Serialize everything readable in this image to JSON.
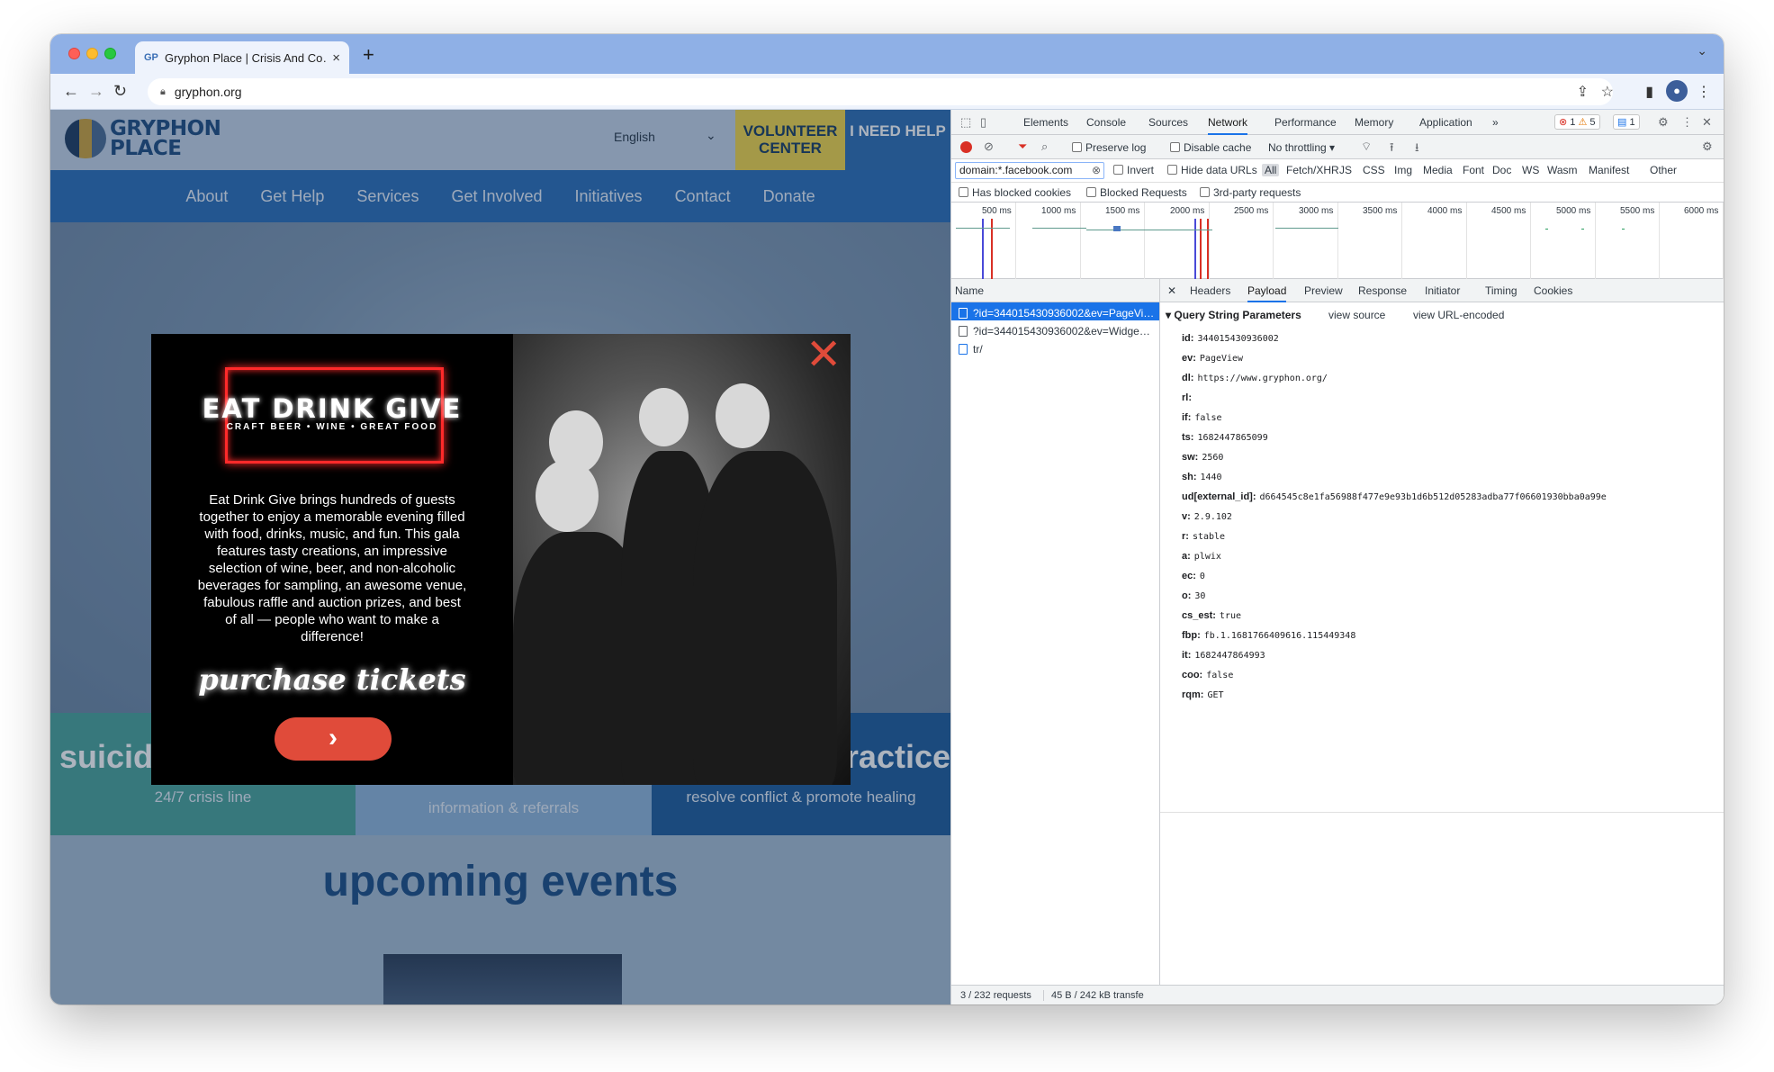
{
  "browser": {
    "tab_title": "Gryphon Place | Crisis And Co…",
    "tab_favicon": "GP",
    "url": "gryphon.org",
    "new_tab_symbol": "+"
  },
  "site": {
    "logo_line1": "GRYPHON",
    "logo_line2": "PLACE",
    "language": "English",
    "volunteer_button": "VOLUNTEER CENTER",
    "help_button": "I NEED HELP",
    "nav": [
      "About",
      "Get Help",
      "Services",
      "Get Involved",
      "Initiatives",
      "Contact",
      "Donate"
    ],
    "features": [
      {
        "big": "suicid",
        "small": "24/7 crisis line"
      },
      {
        "big": "",
        "small": "information & referrals"
      },
      {
        "big": "ractice",
        "small": "resolve conflict & promote healing"
      }
    ],
    "events_title": "upcoming events"
  },
  "popup": {
    "title": "EAT DRINK GIVE",
    "subtitle": "CRAFT BEER • WINE • GREAT FOOD",
    "description": "Eat Drink Give brings hundreds of guests together to enjoy a memorable evening filled with food, drinks, music, and fun. This gala features tasty creations, an impressive selection of wine, beer, and non-alcoholic beverages for sampling, an awesome venue, fabulous raffle and auction prizes, and best of all — people who want to make a difference!",
    "cta_script": "purchase tickets",
    "cta_arrow": "›",
    "close_symbol": "✕"
  },
  "devtools": {
    "tabs": [
      "Elements",
      "Console",
      "Sources",
      "Network",
      "Performance",
      "Memory",
      "Application"
    ],
    "active_tab": "Network",
    "more_tabs": "»",
    "errors": "1",
    "warnings": "5",
    "messages": "1",
    "preserve_log": "Preserve log",
    "disable_cache": "Disable cache",
    "throttling": "No throttling",
    "filter_value": "domain:*.facebook.com",
    "invert": "Invert",
    "hide_data_urls": "Hide data URLs",
    "types": [
      "All",
      "Fetch/XHR",
      "JS",
      "CSS",
      "Img",
      "Media",
      "Font",
      "Doc",
      "WS",
      "Wasm",
      "Manifest",
      "Other"
    ],
    "has_blocked_cookies": "Has blocked cookies",
    "blocked_requests": "Blocked Requests",
    "third_party": "3rd-party requests",
    "timeline_ticks": [
      "500 ms",
      "1000 ms",
      "1500 ms",
      "2000 ms",
      "2500 ms",
      "3000 ms",
      "3500 ms",
      "4000 ms",
      "4500 ms",
      "5000 ms",
      "5500 ms",
      "6000 ms"
    ],
    "name_header": "Name",
    "requests": [
      "?id=344015430936002&ev=PageView…",
      "?id=344015430936002&ev=Widge…",
      "tr/"
    ],
    "detail_tabs": [
      "Headers",
      "Payload",
      "Preview",
      "Response",
      "Initiator",
      "Timing",
      "Cookies"
    ],
    "active_detail_tab": "Payload",
    "qsp_title": "Query String Parameters",
    "view_source": "view source",
    "view_url_encoded": "view URL-encoded",
    "params": [
      {
        "k": "id:",
        "v": "344015430936002"
      },
      {
        "k": "ev:",
        "v": "PageView"
      },
      {
        "k": "dl:",
        "v": "https://www.gryphon.org/"
      },
      {
        "k": "rl:",
        "v": ""
      },
      {
        "k": "if:",
        "v": "false"
      },
      {
        "k": "ts:",
        "v": "1682447865099"
      },
      {
        "k": "sw:",
        "v": "2560"
      },
      {
        "k": "sh:",
        "v": "1440"
      },
      {
        "k": "ud[external_id]:",
        "v": "d664545c8e1fa56988f477e9e93b1d6b512d05283adba77f06601930bba0a99e"
      },
      {
        "k": "v:",
        "v": "2.9.102"
      },
      {
        "k": "r:",
        "v": "stable"
      },
      {
        "k": "a:",
        "v": "plwix"
      },
      {
        "k": "ec:",
        "v": "0"
      },
      {
        "k": "o:",
        "v": "30"
      },
      {
        "k": "cs_est:",
        "v": "true"
      },
      {
        "k": "fbp:",
        "v": "fb.1.1681766409616.115449348"
      },
      {
        "k": "it:",
        "v": "1682447864993"
      },
      {
        "k": "coo:",
        "v": "false"
      },
      {
        "k": "rqm:",
        "v": "GET"
      }
    ],
    "status_requests": "3 / 232 requests",
    "status_transfer": "45 B / 242 kB transfe"
  },
  "colors": {
    "site_nav": "#2b6fb8",
    "volunteer": "#f2d64a",
    "popup_accent": "#e04b3a",
    "devtools_selection": "#1a73e8"
  }
}
